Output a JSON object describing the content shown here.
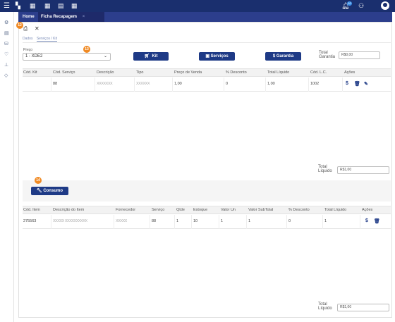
{
  "topbar": {
    "menu_icon": "hamburger-icon",
    "logo": "logo-icon",
    "icons": [
      "calendar-icon",
      "calendar-icon",
      "print-icon",
      "calendar-icon"
    ],
    "notifications_count": "10",
    "bell_icon": "bell-icon",
    "user_add_icon": "user-add-icon",
    "avatar_icon": "avatar-icon"
  },
  "tabs": [
    {
      "label": "Home"
    },
    {
      "label": "Ficha Recapagem"
    }
  ],
  "toolbar": {
    "print_icon": "print-icon",
    "close_icon": "close-icon"
  },
  "markers": {
    "m1": "12",
    "m2": "13",
    "m3": "14"
  },
  "subtabs": [
    {
      "label": "Dados"
    },
    {
      "label": "Serviços / Kit"
    }
  ],
  "preco": {
    "label": "Preço",
    "value": "1 - XDE2"
  },
  "buttons": {
    "kit": "Kit",
    "servicos": "Serviços",
    "garantia": "Garantia",
    "consumo": "Consumo"
  },
  "total_garantia": {
    "label1": "Total",
    "label2": "Garantia",
    "value": "R$0,00"
  },
  "table1": {
    "headers": [
      "Cód. Kit",
      "Cód. Serviço",
      "Descrição",
      "Tipo",
      "Preço de Venda",
      "% Desconto",
      "Total Líquido",
      "Cód. L.C.",
      "Ações"
    ],
    "rows": [
      [
        "",
        "88",
        "XXXXXXX",
        "XXXXXX",
        "1,00",
        "0",
        "1,00",
        "1002"
      ]
    ]
  },
  "total_liquido_1": {
    "label1": "Total",
    "label2": "Líquido",
    "value": "R$1,00"
  },
  "table2": {
    "headers": [
      "Cód. Item",
      "Descrição do Item",
      "Fornecedor",
      "Serviço",
      "Qtde",
      "Estoque",
      "Valor Un",
      "Valor SubTotal",
      "% Desconto",
      "Total Líquido",
      "Ações"
    ],
    "rows": [
      [
        "275563",
        "XXXXX XXXXXXXXXX",
        "XXXXX",
        "88",
        "1",
        "10",
        "1",
        "1",
        "0",
        "1"
      ]
    ]
  },
  "total_liquido_2": {
    "label1": "Total",
    "label2": "Líquido",
    "value": "R$1,00"
  }
}
